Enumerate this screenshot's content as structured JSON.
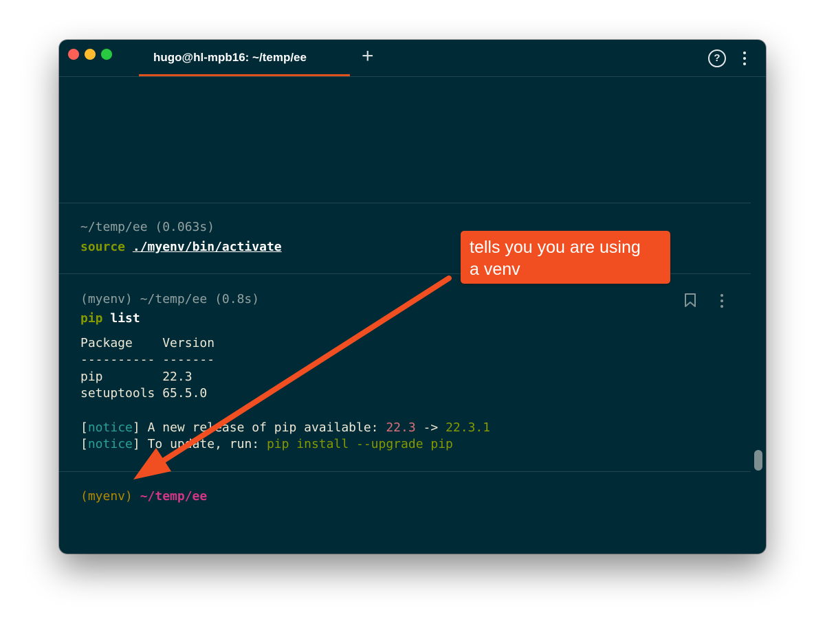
{
  "window": {
    "tab_title": "hugo@hl-mpb16: ~/temp/ee",
    "new_tab_label": "+",
    "help_label": "?"
  },
  "blocks": [
    {
      "header": "~/temp/ee (0.063s)",
      "command_keyword": "source",
      "command_rest": "./myenv/bin/activate"
    },
    {
      "header": "(myenv) ~/temp/ee (0.8s)",
      "command_keyword": "pip",
      "command_rest": "list",
      "output": {
        "columns": [
          "Package",
          "Version"
        ],
        "rule": "---------- -------",
        "rows": [
          {
            "package": "pip",
            "version": "22.3"
          },
          {
            "package": "setuptools",
            "version": "65.5.0"
          }
        ],
        "notices": [
          {
            "tag": "notice",
            "text_before": "A new release of pip available: ",
            "old_version": "22.3",
            "arrow": "->",
            "new_version": "22.3.1"
          },
          {
            "tag": "notice",
            "text_before": "To update, run: ",
            "command": "pip install --upgrade pip"
          }
        ]
      }
    }
  ],
  "prompt": {
    "env": "(myenv)",
    "path": "~/temp/ee"
  },
  "annotation": {
    "line1": "tells you you are using",
    "line2": "a venv"
  },
  "colors": {
    "background": "#002b36",
    "accent": "#e0531f",
    "callout": "#f14f21",
    "env_prompt": "#b58900",
    "path_prompt": "#d33682"
  },
  "icons": [
    "help-icon",
    "more-options-icon",
    "bookmark-icon",
    "plus-icon"
  ]
}
